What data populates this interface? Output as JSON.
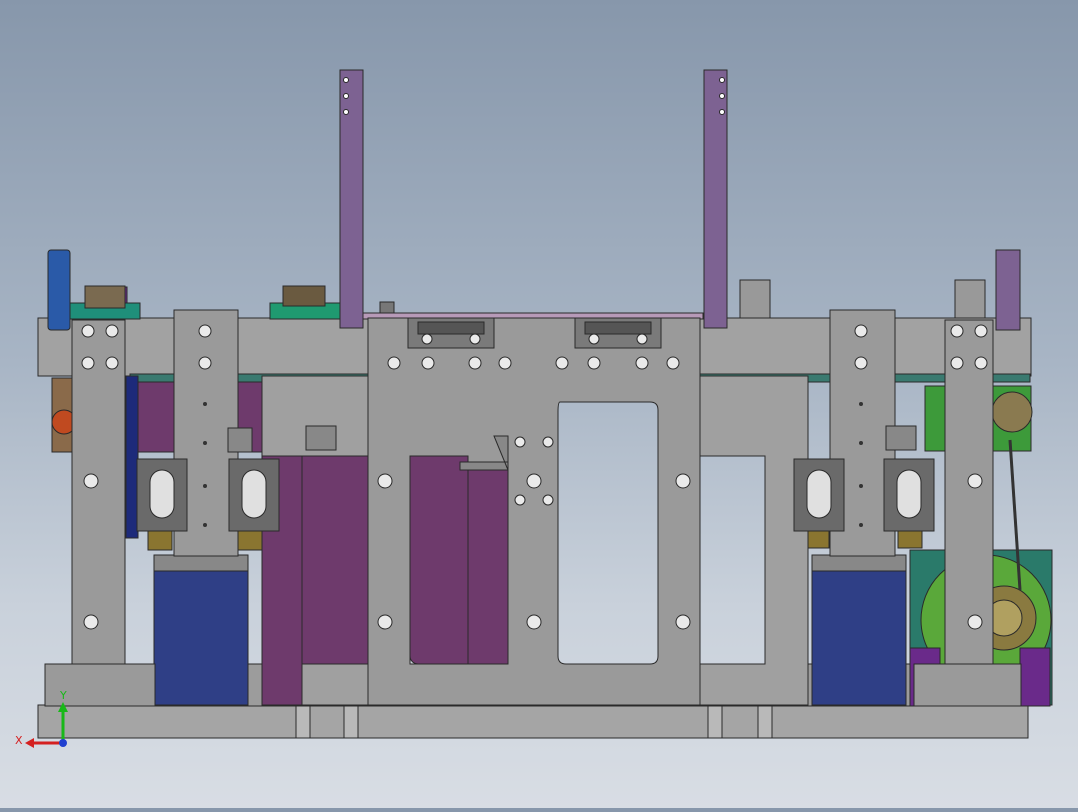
{
  "viewport": {
    "background_top": "#8797ab",
    "background_bottom": "#d8dde4"
  },
  "triad": {
    "x_label": "X",
    "y_label": "Y",
    "x_color": "#d42020",
    "y_color": "#18b818",
    "z_color": "#2040d0"
  },
  "colors": {
    "plate": "#9a9a9a",
    "plate_light": "#b4b4b4",
    "purple": "#6e3a6c",
    "lavender": "#7d6292",
    "navy": "#1d2a7a",
    "motor_blue": "#2f3f86",
    "teal": "#1f8f7a",
    "green": "#3d9a3a",
    "brass": "#8a7530",
    "dark": "#4a4a4a",
    "outline": "#2a2a2a"
  }
}
